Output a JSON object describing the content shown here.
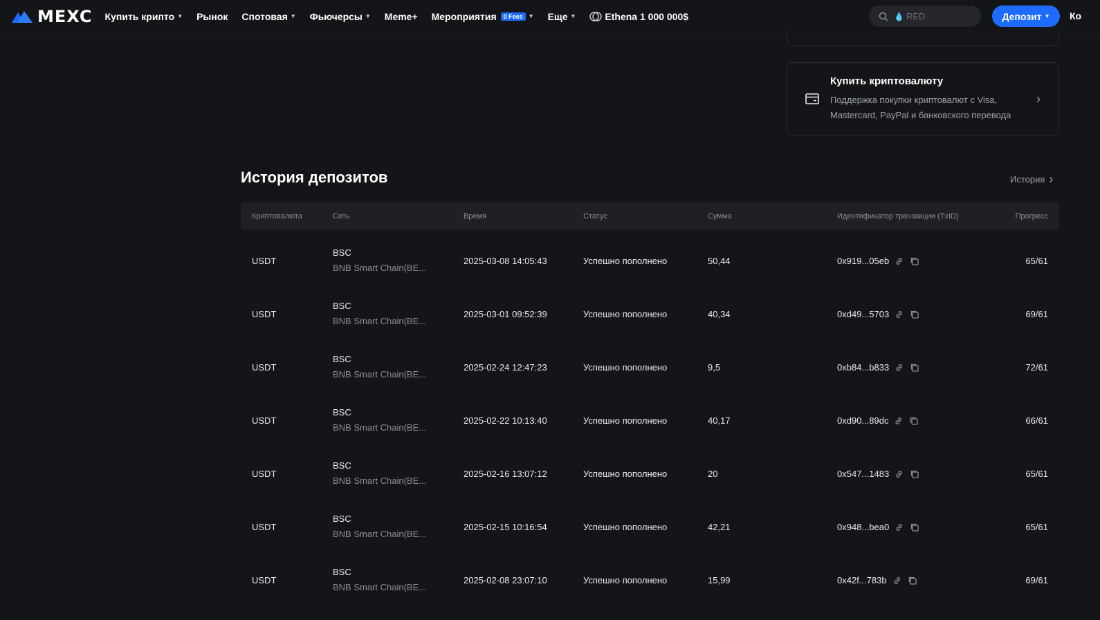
{
  "header": {
    "logo_text": "MEXC",
    "nav": [
      {
        "label": "Купить крипто",
        "caret": true
      },
      {
        "label": "Рынок",
        "caret": false
      },
      {
        "label": "Спотовая",
        "caret": true
      },
      {
        "label": "Фьючерсы",
        "caret": true
      },
      {
        "label": "Meme+",
        "caret": false
      },
      {
        "label": "Мероприятия",
        "caret": true,
        "badge": "0 Fees"
      },
      {
        "label": "Еще",
        "caret": true
      }
    ],
    "promo_label": "Ethena 1 000 000$",
    "search_placeholder": "RED",
    "deposit_label": "Депозит",
    "wallet_cut": "Ко"
  },
  "buy_card": {
    "title": "Купить криптовалюту",
    "description": "Поддержка покупки криптовалют с Visa, Mastercard, PayPal и банковского перевода"
  },
  "history": {
    "title": "История депозитов",
    "link": "История",
    "columns": [
      "Криптовалюта",
      "Сеть",
      "Время",
      "Статус",
      "Сумма",
      "Идентификатор транзакции (TxID)",
      "Прогресс"
    ],
    "rows": [
      {
        "coin": "USDT",
        "network": "BSC",
        "network_full": "BNB Smart Chain(BE...",
        "time": "2025-03-08 14:05:43",
        "status": "Успешно пополнено",
        "amount": "50,44",
        "txid": "0x919...05eb",
        "progress": "65/61"
      },
      {
        "coin": "USDT",
        "network": "BSC",
        "network_full": "BNB Smart Chain(BE...",
        "time": "2025-03-01 09:52:39",
        "status": "Успешно пополнено",
        "amount": "40,34",
        "txid": "0xd49...5703",
        "progress": "69/61"
      },
      {
        "coin": "USDT",
        "network": "BSC",
        "network_full": "BNB Smart Chain(BE...",
        "time": "2025-02-24 12:47:23",
        "status": "Успешно пополнено",
        "amount": "9,5",
        "txid": "0xb84...b833",
        "progress": "72/61"
      },
      {
        "coin": "USDT",
        "network": "BSC",
        "network_full": "BNB Smart Chain(BE...",
        "time": "2025-02-22 10:13:40",
        "status": "Успешно пополнено",
        "amount": "40,17",
        "txid": "0xd90...89dc",
        "progress": "66/61"
      },
      {
        "coin": "USDT",
        "network": "BSC",
        "network_full": "BNB Smart Chain(BE...",
        "time": "2025-02-16 13:07:12",
        "status": "Успешно пополнено",
        "amount": "20",
        "txid": "0x547...1483",
        "progress": "65/61"
      },
      {
        "coin": "USDT",
        "network": "BSC",
        "network_full": "BNB Smart Chain(BE...",
        "time": "2025-02-15 10:16:54",
        "status": "Успешно пополнено",
        "amount": "42,21",
        "txid": "0x948...bea0",
        "progress": "65/61"
      },
      {
        "coin": "USDT",
        "network": "BSC",
        "network_full": "BNB Smart Chain(BE...",
        "time": "2025-02-08 23:07:10",
        "status": "Успешно пополнено",
        "amount": "15,99",
        "txid": "0x42f...783b",
        "progress": "69/61"
      }
    ]
  },
  "colors": {
    "accent": "#1e6cff",
    "background": "#141519",
    "muted": "#8a8e96"
  }
}
